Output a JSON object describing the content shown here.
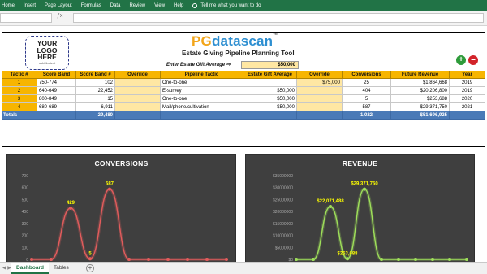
{
  "ribbon": {
    "tabs": [
      "Home",
      "Insert",
      "Page Layout",
      "Formulas",
      "Data",
      "Review",
      "View",
      "Help"
    ],
    "tell_me": "Tell me what you want to do"
  },
  "logo": {
    "line1": "YOUR",
    "line2": "LOGO",
    "line3": "HERE",
    "tagline": "subtitle/text"
  },
  "brand": {
    "pg": "PG",
    "ds": "datascan",
    "tm": "™",
    "subtitle": "Estate Giving Pipeline Planning Tool"
  },
  "gift": {
    "label": "Enter Estate Gift Average",
    "arrow": "⇨",
    "value": "$50,000"
  },
  "buttons": {
    "add": "+",
    "remove": "–"
  },
  "table": {
    "headers": [
      "Tactic #",
      "Score Band",
      "Score Band #",
      "Override",
      "Pipeline Tactic",
      "Estate Gift  Average",
      "Override",
      "Conversions",
      "Future Revenue",
      "Year"
    ],
    "rows": [
      [
        "1",
        "750-774",
        "102",
        "",
        "One-to-one",
        "",
        "$75,000",
        "25",
        "$1,864,668",
        "2019"
      ],
      [
        "2",
        "640-649",
        "22,452",
        "",
        "E-survey",
        "$50,000",
        "",
        "404",
        "$20,206,800",
        "2019"
      ],
      [
        "3",
        "800-849",
        "15",
        "",
        "One-to-one",
        "$50,000",
        "",
        "5",
        "$253,688",
        "2020"
      ],
      [
        "4",
        "680-689",
        "6,911",
        "",
        "Mail/phone/cultivation",
        "$50,000",
        "",
        "587",
        "$29,371,750",
        "2021"
      ]
    ],
    "totals": {
      "label": "Totals",
      "score_band_total": "29,480",
      "conversions_total": "1,022",
      "revenue_total": "$51,696,925"
    }
  },
  "chart_data": [
    {
      "type": "line",
      "title": "CONVERSIONS",
      "ylim": [
        0,
        700
      ],
      "yticks": [
        "0",
        "100",
        "200",
        "300",
        "400",
        "500",
        "600",
        "700"
      ],
      "xlabels": [
        "2019",
        "2020",
        "2021"
      ],
      "series": [
        {
          "values": [
            0,
            0,
            429,
            5,
            587,
            0,
            0,
            0,
            0,
            0,
            0
          ]
        }
      ],
      "point_labels": [
        "429",
        "5",
        "587"
      ],
      "line_color": "#e35c5c"
    },
    {
      "type": "line",
      "title": "REVENUE",
      "ylim": [
        0,
        35000000
      ],
      "yticks": [
        "$0",
        "$5000000",
        "$10000000",
        "$15000000",
        "$20000000",
        "$25000000",
        "$30000000",
        "$35000000"
      ],
      "xlabels": [
        "2019",
        "2020",
        "2021"
      ],
      "series": [
        {
          "values": [
            0,
            0,
            22071488,
            253688,
            29371750,
            0,
            0,
            0,
            0,
            0,
            0
          ]
        }
      ],
      "point_labels": [
        "$22,071,488",
        "$253,688",
        "$29,371,750"
      ],
      "line_color": "#9fe05a"
    }
  ],
  "sheet_tabs": [
    "Dashboard",
    "Tables"
  ]
}
